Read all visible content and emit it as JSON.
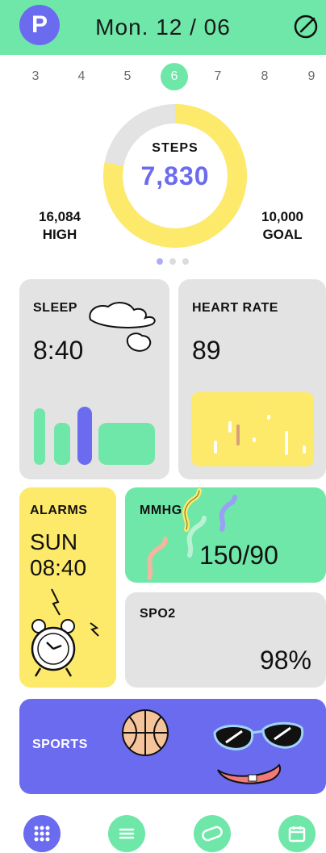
{
  "header": {
    "avatar_letter": "P",
    "date": "Mon. 12 / 06"
  },
  "days": [
    {
      "label": "3",
      "active": false
    },
    {
      "label": "4",
      "active": false
    },
    {
      "label": "5",
      "active": false
    },
    {
      "label": "6",
      "active": true
    },
    {
      "label": "7",
      "active": false
    },
    {
      "label": "8",
      "active": false
    },
    {
      "label": "9",
      "active": false
    }
  ],
  "steps": {
    "label": "STEPS",
    "value": "7,830",
    "progress": 0.78
  },
  "high": {
    "value": "16,084",
    "label": "HIGH"
  },
  "goal": {
    "value": "10,000",
    "label": "GOAL"
  },
  "cards": {
    "sleep": {
      "title": "SLEEP",
      "value": "8:40"
    },
    "heart": {
      "title": "HEART RATE",
      "value": "89"
    },
    "alarms": {
      "title": "ALARMS",
      "day": "SUN",
      "time": "08:40"
    },
    "mmhg": {
      "title": "MMHG",
      "value": "150/90"
    },
    "spo2": {
      "title": "SPO2",
      "value": "98%"
    },
    "sports": {
      "title": "SPORTS"
    }
  },
  "colors": {
    "green": "#6ee7a8",
    "purple": "#6b6bf0",
    "yellow": "#fde96a",
    "gray": "#e3e3e3"
  },
  "icons": {
    "edit": "edit-icon",
    "nav": [
      "grid-icon",
      "sliders-icon",
      "pill-icon",
      "calendar-icon"
    ]
  }
}
